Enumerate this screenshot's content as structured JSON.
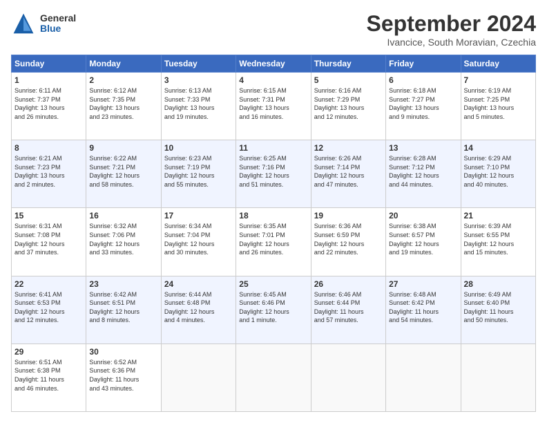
{
  "header": {
    "logo_line1": "General",
    "logo_line2": "Blue",
    "month_title": "September 2024",
    "location": "Ivancice, South Moravian, Czechia"
  },
  "days_of_week": [
    "Sunday",
    "Monday",
    "Tuesday",
    "Wednesday",
    "Thursday",
    "Friday",
    "Saturday"
  ],
  "weeks": [
    [
      {
        "day": "1",
        "info": "Sunrise: 6:11 AM\nSunset: 7:37 PM\nDaylight: 13 hours\nand 26 minutes."
      },
      {
        "day": "2",
        "info": "Sunrise: 6:12 AM\nSunset: 7:35 PM\nDaylight: 13 hours\nand 23 minutes."
      },
      {
        "day": "3",
        "info": "Sunrise: 6:13 AM\nSunset: 7:33 PM\nDaylight: 13 hours\nand 19 minutes."
      },
      {
        "day": "4",
        "info": "Sunrise: 6:15 AM\nSunset: 7:31 PM\nDaylight: 13 hours\nand 16 minutes."
      },
      {
        "day": "5",
        "info": "Sunrise: 6:16 AM\nSunset: 7:29 PM\nDaylight: 13 hours\nand 12 minutes."
      },
      {
        "day": "6",
        "info": "Sunrise: 6:18 AM\nSunset: 7:27 PM\nDaylight: 13 hours\nand 9 minutes."
      },
      {
        "day": "7",
        "info": "Sunrise: 6:19 AM\nSunset: 7:25 PM\nDaylight: 13 hours\nand 5 minutes."
      }
    ],
    [
      {
        "day": "8",
        "info": "Sunrise: 6:21 AM\nSunset: 7:23 PM\nDaylight: 13 hours\nand 2 minutes."
      },
      {
        "day": "9",
        "info": "Sunrise: 6:22 AM\nSunset: 7:21 PM\nDaylight: 12 hours\nand 58 minutes."
      },
      {
        "day": "10",
        "info": "Sunrise: 6:23 AM\nSunset: 7:19 PM\nDaylight: 12 hours\nand 55 minutes."
      },
      {
        "day": "11",
        "info": "Sunrise: 6:25 AM\nSunset: 7:16 PM\nDaylight: 12 hours\nand 51 minutes."
      },
      {
        "day": "12",
        "info": "Sunrise: 6:26 AM\nSunset: 7:14 PM\nDaylight: 12 hours\nand 47 minutes."
      },
      {
        "day": "13",
        "info": "Sunrise: 6:28 AM\nSunset: 7:12 PM\nDaylight: 12 hours\nand 44 minutes."
      },
      {
        "day": "14",
        "info": "Sunrise: 6:29 AM\nSunset: 7:10 PM\nDaylight: 12 hours\nand 40 minutes."
      }
    ],
    [
      {
        "day": "15",
        "info": "Sunrise: 6:31 AM\nSunset: 7:08 PM\nDaylight: 12 hours\nand 37 minutes."
      },
      {
        "day": "16",
        "info": "Sunrise: 6:32 AM\nSunset: 7:06 PM\nDaylight: 12 hours\nand 33 minutes."
      },
      {
        "day": "17",
        "info": "Sunrise: 6:34 AM\nSunset: 7:04 PM\nDaylight: 12 hours\nand 30 minutes."
      },
      {
        "day": "18",
        "info": "Sunrise: 6:35 AM\nSunset: 7:01 PM\nDaylight: 12 hours\nand 26 minutes."
      },
      {
        "day": "19",
        "info": "Sunrise: 6:36 AM\nSunset: 6:59 PM\nDaylight: 12 hours\nand 22 minutes."
      },
      {
        "day": "20",
        "info": "Sunrise: 6:38 AM\nSunset: 6:57 PM\nDaylight: 12 hours\nand 19 minutes."
      },
      {
        "day": "21",
        "info": "Sunrise: 6:39 AM\nSunset: 6:55 PM\nDaylight: 12 hours\nand 15 minutes."
      }
    ],
    [
      {
        "day": "22",
        "info": "Sunrise: 6:41 AM\nSunset: 6:53 PM\nDaylight: 12 hours\nand 12 minutes."
      },
      {
        "day": "23",
        "info": "Sunrise: 6:42 AM\nSunset: 6:51 PM\nDaylight: 12 hours\nand 8 minutes."
      },
      {
        "day": "24",
        "info": "Sunrise: 6:44 AM\nSunset: 6:48 PM\nDaylight: 12 hours\nand 4 minutes."
      },
      {
        "day": "25",
        "info": "Sunrise: 6:45 AM\nSunset: 6:46 PM\nDaylight: 12 hours\nand 1 minute."
      },
      {
        "day": "26",
        "info": "Sunrise: 6:46 AM\nSunset: 6:44 PM\nDaylight: 11 hours\nand 57 minutes."
      },
      {
        "day": "27",
        "info": "Sunrise: 6:48 AM\nSunset: 6:42 PM\nDaylight: 11 hours\nand 54 minutes."
      },
      {
        "day": "28",
        "info": "Sunrise: 6:49 AM\nSunset: 6:40 PM\nDaylight: 11 hours\nand 50 minutes."
      }
    ],
    [
      {
        "day": "29",
        "info": "Sunrise: 6:51 AM\nSunset: 6:38 PM\nDaylight: 11 hours\nand 46 minutes."
      },
      {
        "day": "30",
        "info": "Sunrise: 6:52 AM\nSunset: 6:36 PM\nDaylight: 11 hours\nand 43 minutes."
      },
      {
        "day": "",
        "info": ""
      },
      {
        "day": "",
        "info": ""
      },
      {
        "day": "",
        "info": ""
      },
      {
        "day": "",
        "info": ""
      },
      {
        "day": "",
        "info": ""
      }
    ]
  ]
}
